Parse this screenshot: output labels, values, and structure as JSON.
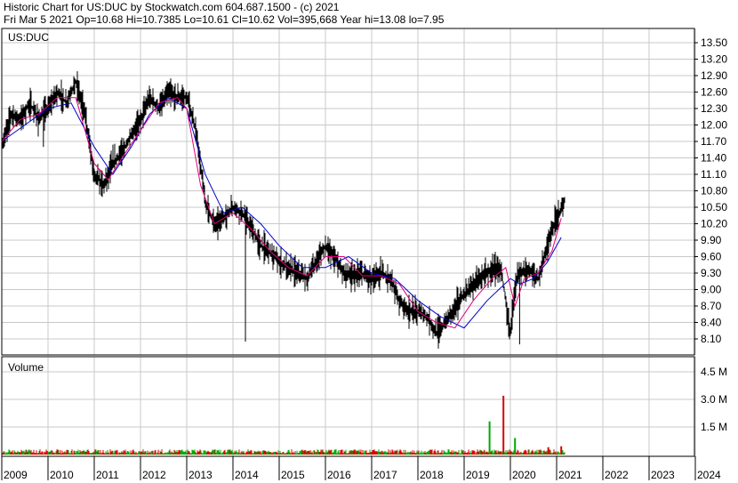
{
  "header": {
    "line1": "Historic Chart for US:DUC by Stockwatch.com 604.687.1500 - (c) 2021",
    "line2": "Fri Mar  5 2021   Op=10.68   Hi=10.7385   Lo=10.61   Cl=10.62   Vol=395,668   Year hi=13.08   lo=7.95"
  },
  "colors": {
    "price_bar": "#000000",
    "ma_short": "#e0007a",
    "ma_long": "#0000cc",
    "volume_up": "#00aa00",
    "volume_down": "#dd0000",
    "grid": "#c8c8c8",
    "background": "#ffffff"
  },
  "chart_data": [
    {
      "type": "line",
      "title": "US:DUC",
      "ylim": [
        7.95,
        13.6
      ],
      "y_ticks": [
        "13.50",
        "13.20",
        "12.90",
        "12.60",
        "12.30",
        "12.00",
        "11.70",
        "11.40",
        "11.10",
        "10.80",
        "10.50",
        "10.20",
        "9.90",
        "9.60",
        "9.30",
        "9.00",
        "8.70",
        "8.40",
        "8.10"
      ],
      "x_ticks": [
        "2009",
        "2010",
        "2011",
        "2012",
        "2013",
        "2014",
        "2015",
        "2016",
        "2017",
        "2018",
        "2019",
        "2020",
        "2021",
        "2022",
        "2023",
        "2024"
      ],
      "x_range": [
        2009.0,
        2024.4
      ],
      "grid": true,
      "series": [
        {
          "kind": "price",
          "x": [
            2009.0,
            2009.2,
            2009.4,
            2009.6,
            2009.8,
            2010.0,
            2010.2,
            2010.4,
            2010.6,
            2010.8,
            2011.0,
            2011.2,
            2011.4,
            2011.6,
            2011.8,
            2012.0,
            2012.2,
            2012.4,
            2012.6,
            2012.8,
            2013.0,
            2013.2,
            2013.4,
            2013.6,
            2013.8,
            2014.0,
            2014.2,
            2014.4,
            2014.6,
            2014.8,
            2015.0,
            2015.2,
            2015.4,
            2015.6,
            2015.8,
            2016.0,
            2016.2,
            2016.4,
            2016.6,
            2016.8,
            2017.0,
            2017.2,
            2017.4,
            2017.6,
            2017.8,
            2018.0,
            2018.2,
            2018.4,
            2018.6,
            2018.8,
            2019.0,
            2019.2,
            2019.4,
            2019.6,
            2019.8,
            2020.0,
            2020.1,
            2020.2,
            2020.4,
            2020.6,
            2020.8,
            2021.0,
            2021.18
          ],
          "values": [
            11.6,
            12.2,
            12.1,
            12.4,
            12.1,
            12.3,
            12.6,
            12.4,
            12.8,
            12.2,
            11.1,
            10.9,
            11.3,
            11.5,
            11.8,
            12.1,
            12.5,
            12.3,
            12.6,
            12.5,
            12.5,
            11.9,
            10.6,
            10.2,
            10.3,
            10.5,
            10.4,
            10.1,
            9.8,
            9.7,
            9.5,
            9.4,
            9.3,
            9.2,
            9.5,
            9.8,
            9.6,
            9.3,
            9.25,
            9.28,
            9.2,
            9.3,
            9.2,
            8.8,
            8.6,
            8.6,
            8.5,
            8.2,
            8.4,
            8.7,
            8.9,
            9.1,
            9.25,
            9.35,
            9.4,
            8.2,
            9.1,
            9.3,
            9.35,
            9.2,
            9.8,
            10.3,
            10.62
          ]
        },
        {
          "kind": "moving_average_short",
          "x": [
            2009.0,
            2009.4,
            2009.8,
            2010.2,
            2010.6,
            2011.0,
            2011.3,
            2011.6,
            2012.0,
            2012.4,
            2012.8,
            2013.0,
            2013.3,
            2013.6,
            2014.0,
            2014.4,
            2014.8,
            2015.2,
            2015.6,
            2016.0,
            2016.4,
            2016.8,
            2017.2,
            2017.6,
            2018.0,
            2018.4,
            2018.8,
            2019.2,
            2019.6,
            2019.9,
            2020.1,
            2020.3,
            2020.6,
            2020.9,
            2021.1
          ],
          "values": [
            11.7,
            12.1,
            12.2,
            12.5,
            12.5,
            11.3,
            11.0,
            11.4,
            11.9,
            12.4,
            12.5,
            12.3,
            10.9,
            10.2,
            10.4,
            10.1,
            9.7,
            9.4,
            9.25,
            9.6,
            9.6,
            9.25,
            9.25,
            9.1,
            8.6,
            8.4,
            8.3,
            8.8,
            9.2,
            9.4,
            8.7,
            9.2,
            9.3,
            9.7,
            10.3
          ]
        },
        {
          "kind": "moving_average_long",
          "x": [
            2009.0,
            2009.5,
            2010.0,
            2010.5,
            2011.0,
            2011.4,
            2011.8,
            2012.2,
            2012.6,
            2013.0,
            2013.4,
            2013.8,
            2014.2,
            2014.6,
            2015.0,
            2015.5,
            2016.0,
            2016.5,
            2017.0,
            2017.5,
            2018.0,
            2018.5,
            2019.0,
            2019.5,
            2020.0,
            2020.2,
            2020.5,
            2020.8,
            2021.1
          ],
          "values": [
            11.7,
            12.0,
            12.3,
            12.4,
            11.6,
            11.1,
            11.6,
            12.2,
            12.5,
            12.3,
            11.1,
            10.4,
            10.5,
            10.2,
            9.8,
            9.4,
            9.4,
            9.6,
            9.3,
            9.2,
            8.8,
            8.5,
            8.3,
            8.8,
            9.2,
            9.1,
            9.2,
            9.5,
            9.95
          ]
        }
      ]
    },
    {
      "type": "bar",
      "title": "Volume",
      "ylim": [
        0,
        5500000
      ],
      "y_ticks": [
        "4.5 M",
        "3.0 M",
        "1.5 M"
      ],
      "series": [
        {
          "kind": "baseline_volume",
          "x_range": [
            2009.0,
            2021.18
          ],
          "typical": 180000
        },
        {
          "kind": "volume_spikes",
          "points": [
            {
              "x": 2019.55,
              "value": 1800000,
              "dir": "up"
            },
            {
              "x": 2019.85,
              "value": 3200000,
              "dir": "down"
            },
            {
              "x": 2020.1,
              "value": 900000,
              "dir": "up"
            },
            {
              "x": 2020.82,
              "value": 400000,
              "dir": "down"
            },
            {
              "x": 2021.1,
              "value": 450000,
              "dir": "down"
            }
          ]
        }
      ]
    }
  ]
}
